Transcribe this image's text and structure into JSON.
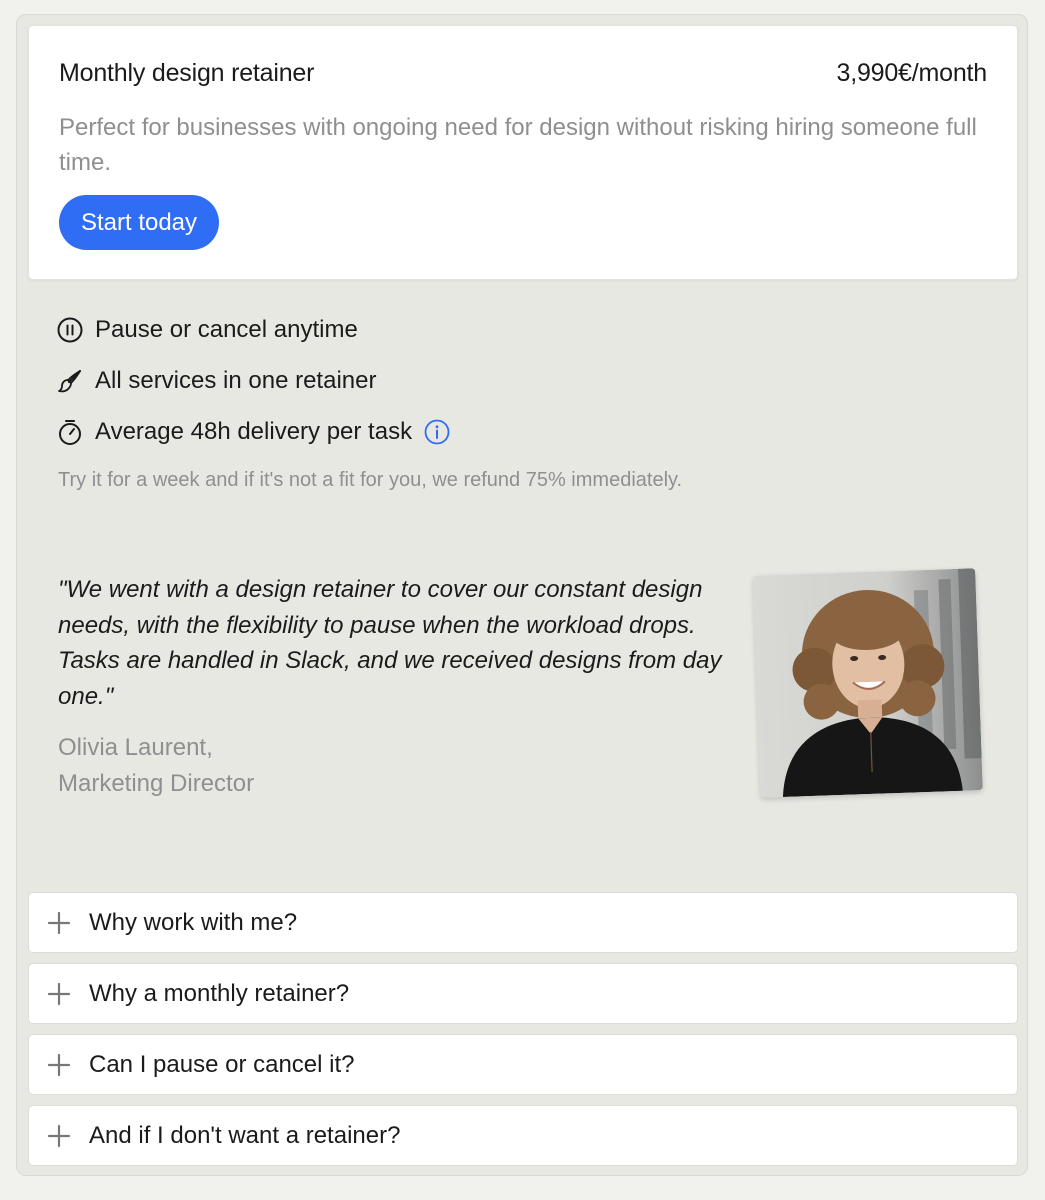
{
  "plan": {
    "name": "Monthly design retainer",
    "price": "3,990€/month",
    "description": "Perfect for businesses with ongoing need for design without risking hiring someone full time.",
    "cta_label": "Start today"
  },
  "features": [
    {
      "icon": "pause-circle-icon",
      "label": "Pause or cancel anytime"
    },
    {
      "icon": "paintbrush-icon",
      "label": "All services in one retainer"
    },
    {
      "icon": "stopwatch-icon",
      "label": "Average 48h delivery per task",
      "info_icon": "info-icon"
    }
  ],
  "guarantee": "Try it for a week and if it's not a fit for you, we refund 75% immediately.",
  "testimonial": {
    "quote": "\"We went with a design retainer to cover our constant design needs, with the flexibility to pause when the workload drops. Tasks are handled in Slack, and we received designs from day one.\"",
    "author_name": "Olivia Laurent,",
    "author_title": "Marketing Director"
  },
  "faq": [
    {
      "question": "Why work with me?"
    },
    {
      "question": "Why a monthly retainer?"
    },
    {
      "question": "Can I pause or cancel it?"
    },
    {
      "question": "And if I don't want a retainer?"
    }
  ],
  "colors": {
    "accent": "#2f6df5",
    "muted_text": "#8f8f8f",
    "panel_bg": "#e8e8e3"
  }
}
